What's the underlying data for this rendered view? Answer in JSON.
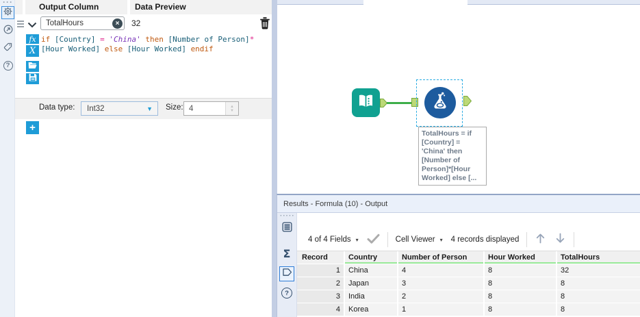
{
  "config": {
    "header": {
      "output_column": "Output Column",
      "data_preview": "Data Preview"
    },
    "field": {
      "name": "TotalHours",
      "preview": "32"
    },
    "formula_lines": [
      [
        {
          "text": "if ",
          "type": "kw"
        },
        {
          "text": "[Country] ",
          "type": "field"
        },
        {
          "text": "= ",
          "type": "op"
        },
        {
          "text": "'China'",
          "type": "str"
        },
        {
          "text": " ",
          "type": "plain"
        },
        {
          "text": "then ",
          "type": "kw"
        },
        {
          "text": "[Number of Person]",
          "type": "field"
        },
        {
          "text": "*",
          "type": "op"
        }
      ],
      [
        {
          "text": "[Hour Worked] ",
          "type": "field"
        },
        {
          "text": "else ",
          "type": "kw"
        },
        {
          "text": "[Hour Worked] ",
          "type": "field"
        },
        {
          "text": "endif",
          "type": "kw"
        }
      ]
    ],
    "datatype_label": "Data type:",
    "datatype_value": "Int32",
    "size_label": "Size:",
    "size_value": "4"
  },
  "canvas": {
    "annotation_lines": [
      "TotalHours = if",
      "[Country] =",
      "'China' then",
      "[Number of",
      "Person]*[Hour",
      "Worked] else [..."
    ]
  },
  "results": {
    "title": "Results - Formula (10) - Output",
    "toolbar": {
      "fields_selector": "4 of 4 Fields",
      "cell_viewer": "Cell Viewer",
      "records_text": "4 records displayed"
    },
    "table": {
      "columns": [
        "Record",
        "Country",
        "Number of Person",
        "Hour Worked",
        "TotalHours"
      ],
      "rows": [
        [
          "1",
          "China",
          "4",
          "8",
          "32"
        ],
        [
          "2",
          "Japan",
          "3",
          "8",
          "8"
        ],
        [
          "3",
          "India",
          "2",
          "8",
          "8"
        ],
        [
          "4",
          "Korea",
          "1",
          "8",
          "8"
        ]
      ]
    }
  },
  "glyphs": {
    "caret_down": "▾",
    "dropdown_caret": "▼",
    "spinner_up": "▲",
    "spinner_down": "▼",
    "sigma": "Σ",
    "plus": "+",
    "clear": "×",
    "question": "?",
    "dots_h": "···",
    "dots_row": "·····"
  },
  "colors": {
    "accent_blue": "#1E9CD7",
    "formula_tool_blue": "#1D5B9E",
    "text_input_teal": "#10A191",
    "connector_green": "#3DAE49",
    "selection_blue": "#29ABE2",
    "header_underline_green": "#97E897",
    "syntax_keyword": "#C05A11",
    "syntax_field": "#185E77",
    "syntax_operator": "#E0218A",
    "syntax_string": "#7A35B8"
  }
}
